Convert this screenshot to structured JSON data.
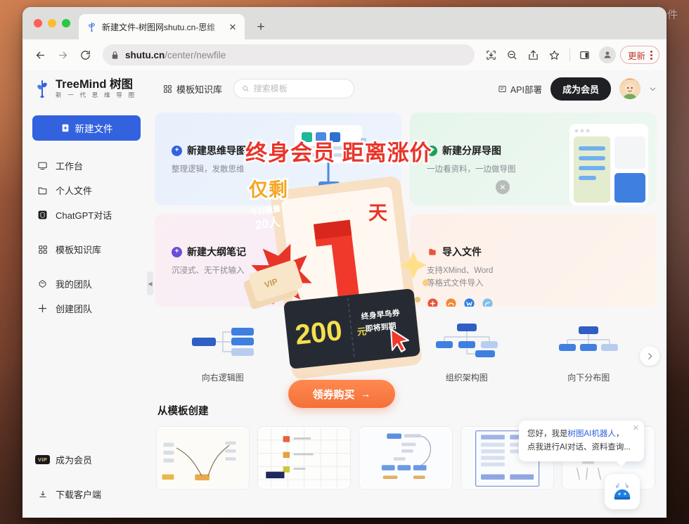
{
  "desktop": {
    "watermark": "小众软件"
  },
  "browser": {
    "tab": {
      "title": "新建文件-树图网shutu.cn-思维",
      "favicon_icon": "treemind-favicon-icon",
      "close_icon": "close-icon"
    },
    "newtab_label": "+",
    "nav": {
      "back_icon": "back-arrow-icon",
      "forward_icon": "forward-arrow-icon",
      "reload_icon": "reload-icon"
    },
    "omnibox": {
      "lock_icon": "lock-icon",
      "url_host": "shutu.cn",
      "url_path": "/center/newfile"
    },
    "toolbar_icons": [
      "download-icon",
      "zoom-out-icon",
      "share-icon",
      "bookmark-star-icon",
      "side-panel-icon",
      "profile-avatar-icon"
    ],
    "update_button": {
      "label": "更新",
      "menu_icon": "kebab-menu-icon"
    }
  },
  "app": {
    "header": {
      "logo_main_en": "TreeMind",
      "logo_main_cn": "树图",
      "logo_sub": "新 一 代 思 维 导 图",
      "logo_icon": "treemind-logo-icon",
      "template_library": {
        "label": "模板知识库",
        "icon": "grid-icon"
      },
      "search": {
        "placeholder": "搜索模板",
        "icon": "search-icon",
        "value": ""
      },
      "api_link": {
        "label": "API部署",
        "icon": "api-icon"
      },
      "member_button": "成为会员",
      "avatar_icon": "user-avatar",
      "chevron_icon": "chevron-down-icon"
    },
    "sidebar": {
      "new_file_button": {
        "label": "新建文件",
        "icon": "new-file-icon"
      },
      "items": [
        {
          "label": "工作台",
          "icon": "workbench-icon"
        },
        {
          "label": "个人文件",
          "icon": "folder-icon"
        },
        {
          "label": "ChatGPT对话",
          "icon": "chatgpt-icon"
        },
        {
          "label": "模板知识库",
          "icon": "grid-icon"
        },
        {
          "label": "我的团队",
          "icon": "team-icon"
        },
        {
          "label": "创建团队",
          "icon": "plus-icon"
        }
      ],
      "become_member": {
        "label": "成为会员",
        "badge": "VIP"
      },
      "download_client": {
        "label": "下载客户端",
        "icon": "download-icon"
      },
      "collapse_icon": "collapse-left-icon"
    },
    "cards": [
      {
        "title": "新建思维导图",
        "desc": "整理逻辑，发散思维",
        "badge_icon": "plus-circle-icon",
        "badge_color": "#3362df",
        "art": "mindmap-thumb-art"
      },
      {
        "title": "新建分屏导图",
        "desc": "一边看资料，一边做导图",
        "badge_icon": "plus-circle-icon",
        "badge_color": "#18a159",
        "art": "splitscreen-thumb-art"
      },
      {
        "title": "新建大纲笔记",
        "desc": "沉浸式、无干扰输入",
        "badge_icon": "plus-circle-icon",
        "badge_color": "#6b4fd8",
        "art": "outline-thumb-art"
      },
      {
        "title": "导入文件",
        "desc": "支持XMind、Word\n等格式文件导入",
        "desc_line1": "支持XMind、Word",
        "desc_line2": "等格式文件导入",
        "badge_icon": "import-icon",
        "badge_color": "#e8563c",
        "art": "import-apps-art",
        "app_icons": [
          "xmind-icon",
          "mindmanager-icon",
          "word-icon",
          "freemind-icon"
        ]
      }
    ],
    "diagram_types": [
      {
        "label": "向右逻辑图",
        "icon": "logic-right-diagram-icon"
      },
      {
        "label": "",
        "icon": "hidden-diagram-icon"
      },
      {
        "label": "组织架构图",
        "icon": "org-chart-icon"
      },
      {
        "label": "向下分布图",
        "icon": "downward-tree-icon"
      }
    ],
    "carousel_next_icon": "chevron-right-icon",
    "template_section_title": "从模板创建",
    "templates": [
      {
        "name": "template-thumb-1"
      },
      {
        "name": "template-thumb-2"
      },
      {
        "name": "template-thumb-3"
      },
      {
        "name": "template-thumb-4"
      },
      {
        "name": "template-thumb-5"
      }
    ],
    "promo": {
      "headline": "终身会员 距离涨价",
      "subline": "仅剩",
      "days_number": "1",
      "days_unit": "天",
      "starburst_line1": "今日限量",
      "starburst_line2": "20人",
      "coupon_amount": "200",
      "coupon_unit": "元",
      "coupon_note_line1": "终身早鸟券",
      "coupon_note_line2": "即将到期",
      "coupon_tag": "仅剩",
      "vip_card_text": "VIP",
      "buy_button": "领券购买",
      "buy_arrow": "→",
      "close_icon": "close-icon",
      "headline_color": "#e8352a",
      "subline_color": "#f5a623",
      "button_color": "#f3703a"
    },
    "chat": {
      "greeting_prefix": "您好，我是",
      "greeting_highlight": "树图AI机器人",
      "greeting_suffix": "，",
      "greeting_line2": "点我进行AI对话、资料查询...",
      "close_icon": "close-icon",
      "fab_icon": "ai-robot-icon"
    }
  }
}
